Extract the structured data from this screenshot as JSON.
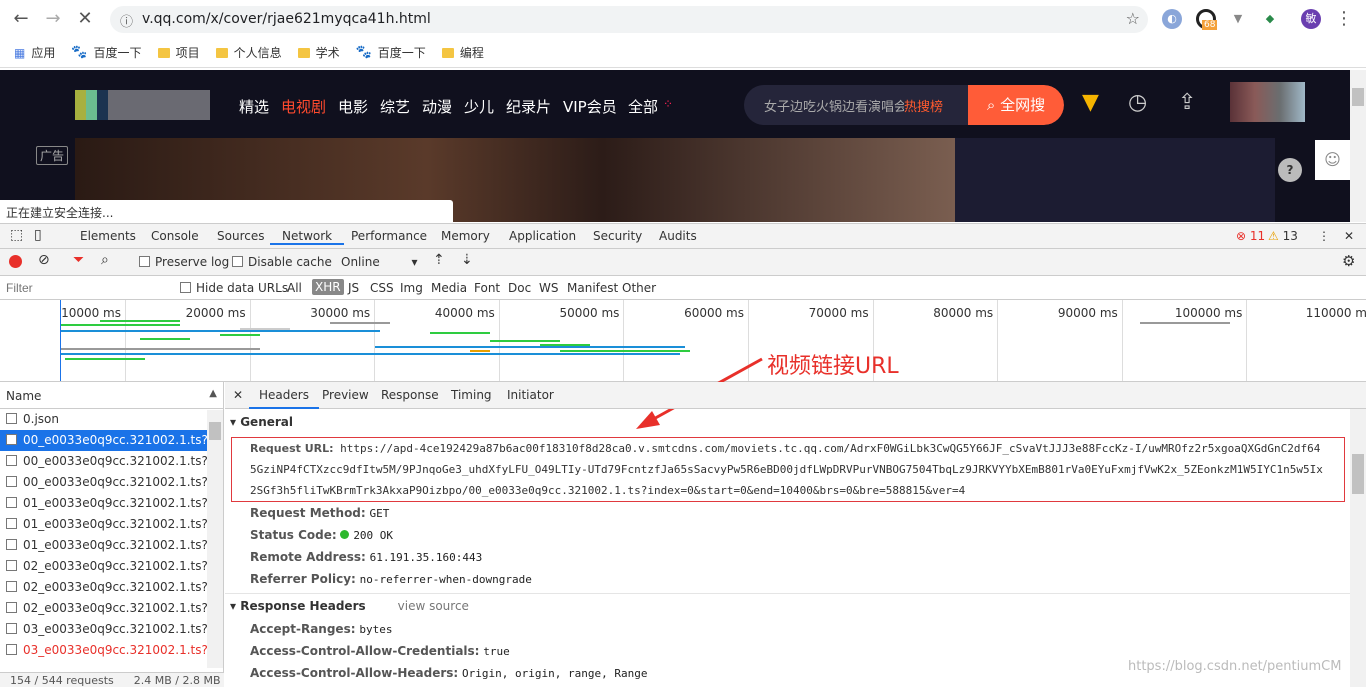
{
  "browser": {
    "url": "v.qq.com/x/cover/rjae621myqca41h.html",
    "ext_badge": "68",
    "avatar_letter": "敏"
  },
  "bookmarks": [
    {
      "label": "应用",
      "icon": "apps-icon"
    },
    {
      "label": "百度一下",
      "icon": "baidu-icon"
    },
    {
      "label": "项目",
      "icon": "folder-icon"
    },
    {
      "label": "个人信息",
      "icon": "folder-icon"
    },
    {
      "label": "学术",
      "icon": "folder-icon"
    },
    {
      "label": "百度一下",
      "icon": "baidu-icon"
    },
    {
      "label": "编程",
      "icon": "folder-icon"
    }
  ],
  "site": {
    "categories": [
      "精选",
      "电视剧",
      "电影",
      "综艺",
      "动漫",
      "少儿",
      "纪录片",
      "VIP会员",
      "全部"
    ],
    "active_category": "电视剧",
    "search_placeholder": "女子边吃火锅边看演唱会",
    "hot_label": "热搜榜",
    "search_button": "全网搜",
    "ad_label": "广告",
    "status": "正在建立安全连接..."
  },
  "devtools": {
    "tabs": [
      "Elements",
      "Console",
      "Sources",
      "Network",
      "Performance",
      "Memory",
      "Application",
      "Security",
      "Audits"
    ],
    "active_tab": "Network",
    "errors": "11",
    "warnings": "13",
    "toolbar": {
      "preserve_log": "Preserve log",
      "disable_cache": "Disable cache",
      "throttle": "Online"
    },
    "filter": {
      "placeholder": "Filter",
      "hide_data_urls": "Hide data URLs",
      "types": [
        "All",
        "XHR",
        "JS",
        "CSS",
        "Img",
        "Media",
        "Font",
        "Doc",
        "WS",
        "Manifest",
        "Other"
      ],
      "active_type": "XHR"
    },
    "timeline_ticks": [
      "10000 ms",
      "20000 ms",
      "30000 ms",
      "40000 ms",
      "50000 ms",
      "60000 ms",
      "70000 ms",
      "80000 ms",
      "90000 ms",
      "100000 ms",
      "110000 m"
    ],
    "annotation": "视频链接URL",
    "name_header": "Name",
    "requests": [
      {
        "name": "0.json",
        "state": "normal"
      },
      {
        "name": "00_e0033e0q9cc.321002.1.ts?index",
        "state": "selected"
      },
      {
        "name": "00_e0033e0q9cc.321002.1.ts?index",
        "state": "normal"
      },
      {
        "name": "00_e0033e0q9cc.321002.1.ts?index",
        "state": "normal"
      },
      {
        "name": "01_e0033e0q9cc.321002.1.ts?index",
        "state": "normal"
      },
      {
        "name": "01_e0033e0q9cc.321002.1.ts?index",
        "state": "normal"
      },
      {
        "name": "01_e0033e0q9cc.321002.1.ts?index",
        "state": "normal"
      },
      {
        "name": "02_e0033e0q9cc.321002.1.ts?index",
        "state": "normal"
      },
      {
        "name": "02_e0033e0q9cc.321002.1.ts?index",
        "state": "normal"
      },
      {
        "name": "02_e0033e0q9cc.321002.1.ts?index",
        "state": "normal"
      },
      {
        "name": "03_e0033e0q9cc.321002.1.ts?index",
        "state": "normal"
      },
      {
        "name": "03_e0033e0q9cc.321002.1.ts?index",
        "state": "error"
      }
    ],
    "footer": {
      "requests": "154 / 544 requests",
      "transferred": "2.4 MB / 2.8 MB tr"
    },
    "detail_tabs": [
      "Headers",
      "Preview",
      "Response",
      "Timing",
      "Initiator"
    ],
    "active_detail_tab": "Headers",
    "general": {
      "title": "General",
      "request_url_label": "Request URL:",
      "request_url": "https://apd-4ce192429a87b6ac00f18310f8d28ca0.v.smtcdns.com/moviets.tc.qq.com/AdrxF0WGiLbk3CwQG5Y66JF_cSvaVtJJJ3e88FccKz-I/uwMROfz2r5xgoaQXGdGnC2df645GziNP4fCTXzcc9dfItw5M/9PJnqoGe3_uhdXfyLFU_O49LTIy-UTd79FcntzfJa65sSacvyPw5R6eBD00jdfLWpDRVPurVNBOG7504TbqLz9JRKVYYbXEmB801rVa0EYuFxmjfVwK2x_5ZEonkzM1W5IYC1n5w5Ix2SGf3h5fliTwKBrmTrk3AkxaP9Oizbpo/00_e0033e0q9cc.321002.1.ts?index=0&start=0&end=10400&brs=0&bre=588815&ver=4",
      "method_label": "Request Method:",
      "method": "GET",
      "status_label": "Status Code:",
      "status": "200 OK",
      "status_color": "#2eb82e",
      "remote_label": "Remote Address:",
      "remote": "61.191.35.160:443",
      "referrer_label": "Referrer Policy:",
      "referrer": "no-referrer-when-downgrade"
    },
    "response_headers": {
      "title": "Response Headers",
      "view_source": "view source",
      "items": [
        {
          "k": "Accept-Ranges:",
          "v": "bytes"
        },
        {
          "k": "Access-Control-Allow-Credentials:",
          "v": "true"
        },
        {
          "k": "Access-Control-Allow-Headers:",
          "v": "Origin, origin, range, Range"
        }
      ]
    }
  },
  "watermark": "https://blog.csdn.net/pentiumCM",
  "colors": {
    "accent": "#1a73e8",
    "error": "#e8302a",
    "brand_orange": "#ff5c38"
  }
}
